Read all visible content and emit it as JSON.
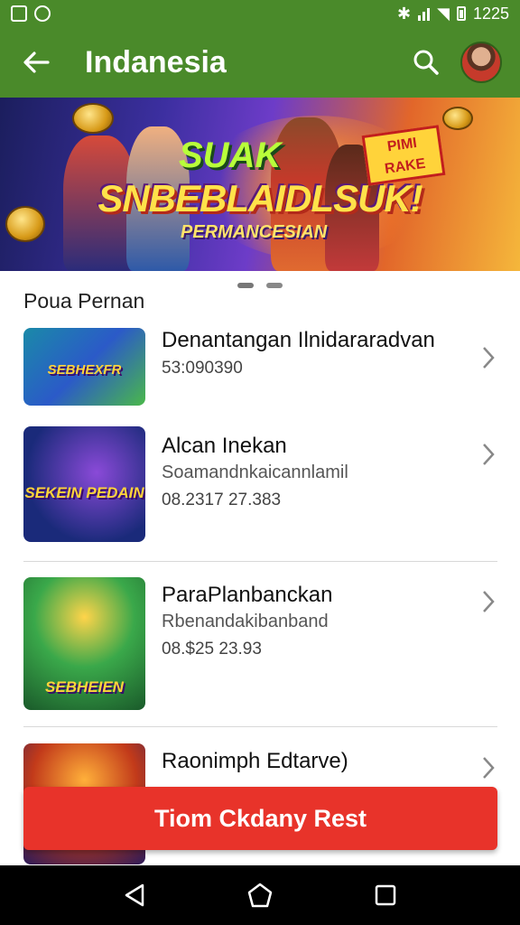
{
  "status_bar": {
    "time": "1225"
  },
  "app_bar": {
    "title": "Indanesia",
    "back_icon": "back-arrow-icon",
    "search_icon": "search-icon"
  },
  "banner": {
    "title_top": "SUAK",
    "title_main": "SNBEBLAIDLSUK!",
    "subtitle": "PERMANCESIAN",
    "badge": "PIMI RAKE",
    "indicator": {
      "active_index": 0,
      "count": 2
    }
  },
  "section": {
    "title": "Poua Pernan"
  },
  "list": [
    {
      "name": "Denantangan Ilnidararadvan",
      "line2": "53:090390",
      "line3": "",
      "thumb_label": "SEBHEXFR"
    },
    {
      "name": "Alcan Inekan",
      "line2": "Soamandnkaicannlamil",
      "line3": "08.2317 27.383",
      "thumb_label": "SEKEIN PEDAIN"
    },
    {
      "name": "ParaPlanbanckan",
      "line2": "Rbenandakibanband",
      "line3": "08.$25 23.93",
      "thumb_label": "SEBHEIEN"
    },
    {
      "name": "Raonimph Edtarve)",
      "line2": "",
      "line3": "",
      "thumb_label": ""
    }
  ],
  "cta": {
    "label": "Tiom Ckdany Rest"
  },
  "colors": {
    "primary": "#4a8a2a",
    "accent": "#e8332a",
    "banner": "#3c2fa0"
  }
}
